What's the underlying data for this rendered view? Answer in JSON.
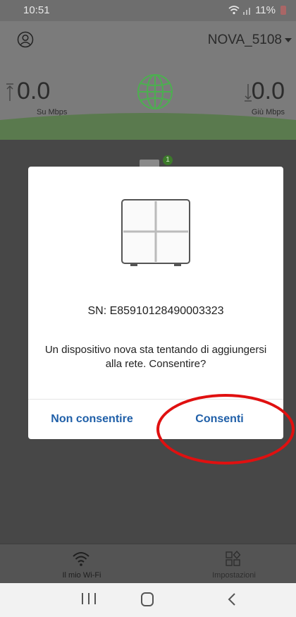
{
  "status_bar": {
    "time": "10:51",
    "battery": "11%"
  },
  "header": {
    "network_name": "NOVA_5108"
  },
  "speed": {
    "upload_value": "0.0",
    "upload_label": "Su Mbps",
    "download_value": "0.0",
    "download_label": "Giù Mbps"
  },
  "map": {
    "node_count_badge": "1"
  },
  "dialog": {
    "serial": "SN: E85910128490003323",
    "message": "Un dispositivo nova sta tentando di aggiungersi alla rete. Consentire?",
    "deny_label": "Non consentire",
    "allow_label": "Consenti"
  },
  "tabs": [
    {
      "label": "Il mio Wi-Fi",
      "icon": "wifi-icon"
    },
    {
      "label": "Impostazioni",
      "icon": "settings-grid-icon"
    }
  ],
  "colors": {
    "accent_blue": "#1f5fa8",
    "globe_green": "#4caf50",
    "annotation_red": "#e01010"
  }
}
